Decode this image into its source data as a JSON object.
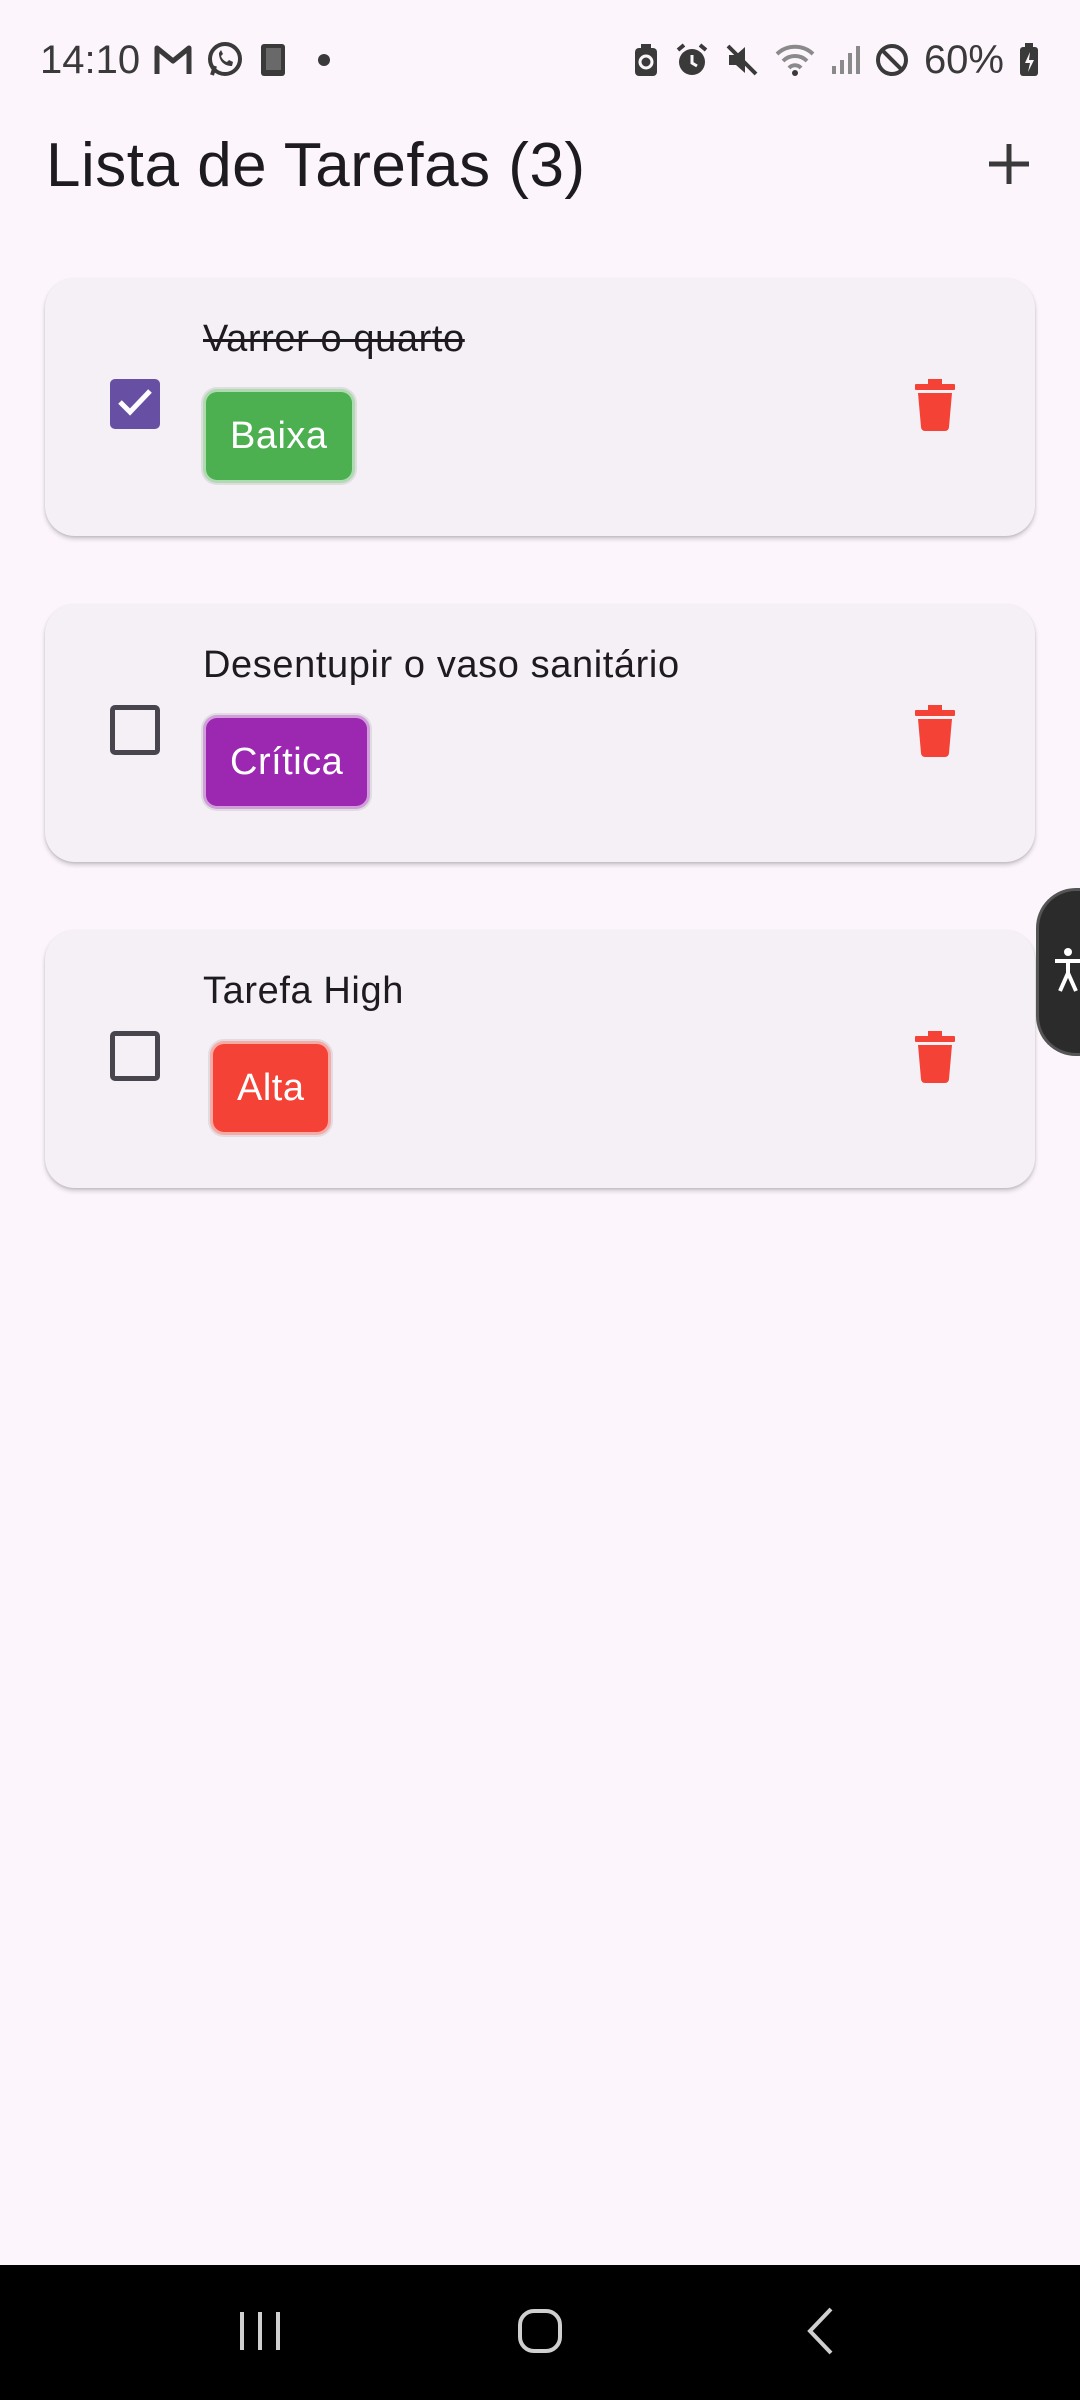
{
  "status_bar": {
    "time": "14:10",
    "battery": "60%",
    "left_icons": [
      "gmail-icon",
      "whatsapp-icon",
      "book-icon",
      "dot-icon"
    ],
    "right_icons": [
      "battery-saver-icon",
      "alarm-icon",
      "mute-icon",
      "wifi-icon",
      "signal-icon",
      "dnd-icon",
      "battery-icon"
    ]
  },
  "app_bar": {
    "title": "Lista de Tarefas (3)",
    "add_icon": "plus-icon"
  },
  "tasks": [
    {
      "title": "Varrer o quarto",
      "completed": true,
      "priority": "Baixa",
      "priority_color": "#4caf50"
    },
    {
      "title": "Desentupir o vaso sanitário",
      "completed": false,
      "priority": "Crítica",
      "priority_color": "#9c27b0"
    },
    {
      "title": "Tarefa High",
      "completed": false,
      "priority": "Alta",
      "priority_color": "#f44336"
    }
  ],
  "colors": {
    "accent": "#6750a4",
    "delete": "#f44336",
    "background": "#fcf6fc",
    "card": "#f4f0f6"
  },
  "nav_bar": {
    "buttons": [
      "recents-icon",
      "home-icon",
      "back-icon"
    ]
  }
}
